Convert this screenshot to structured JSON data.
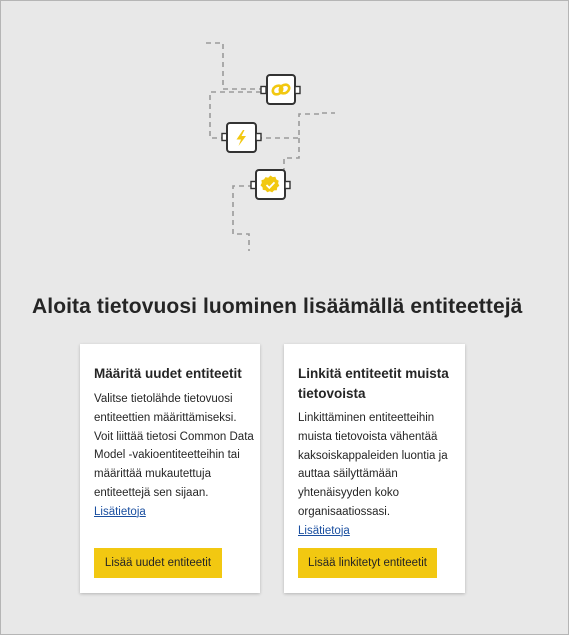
{
  "heading": "Aloita tietovuosi luominen lisäämällä entiteettejä",
  "cards": [
    {
      "title": "Määritä uudet entiteetit",
      "body": "Valitse tietolähde tietovuosi entiteettien määrittämiseksi. Voit liittää tietosi Common Data Model -vakioentiteetteihin tai määrittää mukautettuja entiteettejä sen sijaan.",
      "link": "Lisätietoja",
      "button": "Lisää uudet entiteetit"
    },
    {
      "title": "Linkitä entiteetit muista tietovoista",
      "body": "Linkittäminen entiteetteihin muista tietovoista vähentää kaksoiskappaleiden luontia ja auttaa säilyttämään yhtenäisyyden koko organisaatiossasi.",
      "link": "Lisätietoja",
      "button": "Lisää linkitetyt entiteetit"
    }
  ],
  "illustration": {
    "icons": [
      "link-icon",
      "lightning-icon",
      "verified-badge-icon"
    ],
    "accent_color": "#f2c811",
    "line_color": "#9a9a9a"
  }
}
